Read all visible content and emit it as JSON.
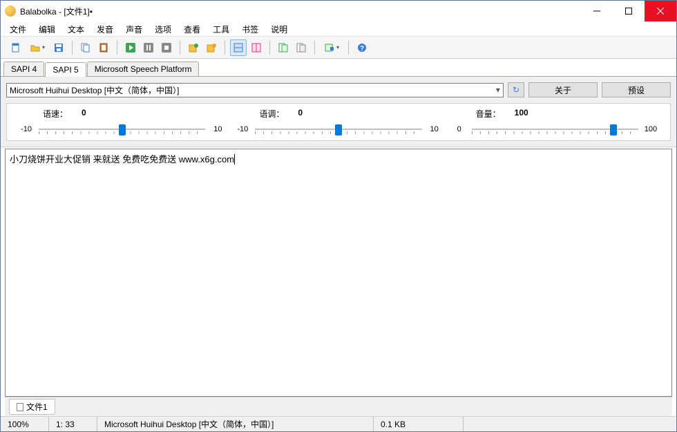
{
  "window": {
    "title": "Balabolka - [文件1]•"
  },
  "menu": [
    "文件",
    "编辑",
    "文本",
    "发音",
    "声音",
    "选项",
    "查看",
    "工具",
    "书签",
    "说明"
  ],
  "toolbar": {
    "new": "new-file",
    "open": "open-file",
    "save": "save",
    "copy": "copy",
    "paste": "paste",
    "play": "play",
    "pause": "pause",
    "stop": "stop",
    "export1": "export-audio",
    "export2": "export-clip",
    "panel1": "panel-a",
    "panel2": "panel-b",
    "script1": "script-a",
    "script2": "script-b",
    "ext": "extension",
    "help": "help"
  },
  "tabs": [
    "SAPI 4",
    "SAPI 5",
    "Microsoft Speech Platform"
  ],
  "active_tab": 1,
  "voice": {
    "selected": "Microsoft Huihui Desktop [中文（简体，中国）]",
    "refresh": "↻",
    "about": "关于",
    "preset": "预设"
  },
  "sliders": {
    "rate": {
      "label": "语速：",
      "value": "0",
      "min": "-10",
      "max": "10",
      "pos": 50
    },
    "pitch": {
      "label": "语调：",
      "value": "0",
      "min": "-10",
      "max": "10",
      "pos": 50
    },
    "volume": {
      "label": "音量：",
      "value": "100",
      "min": "0",
      "max": "100",
      "pos": 85
    }
  },
  "editor": {
    "text": "小刀烧饼开业大促销 来就送 免费吃免费送 www.x6g.com"
  },
  "doc_tab": "文件1",
  "status": {
    "zoom": "100%",
    "pos": "1:  33",
    "voice": "Microsoft Huihui Desktop [中文（简体，中国）]",
    "size": "0.1 KB"
  }
}
